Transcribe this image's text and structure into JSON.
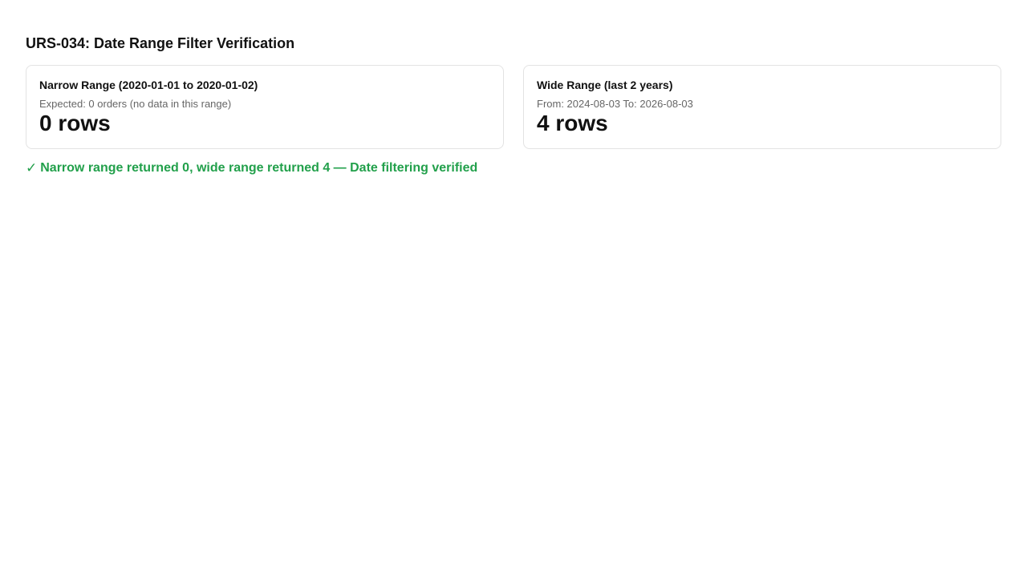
{
  "page": {
    "title": "URS-034: Date Range Filter Verification"
  },
  "cards": [
    {
      "title": "Narrow Range (2020-01-01 to 2020-01-02)",
      "subtitle": "Expected: 0 orders (no data in this range)",
      "value": "0 rows"
    },
    {
      "title": "Wide Range (last 2 years)",
      "subtitle": "From: 2024-08-03 To: 2026-08-03",
      "value": "4 rows"
    }
  ],
  "result": {
    "icon": "check-icon",
    "symbol": "✓",
    "text": "Narrow range returned 0, wide range returned 4 — Date filtering verified",
    "color": "#22a04b"
  }
}
